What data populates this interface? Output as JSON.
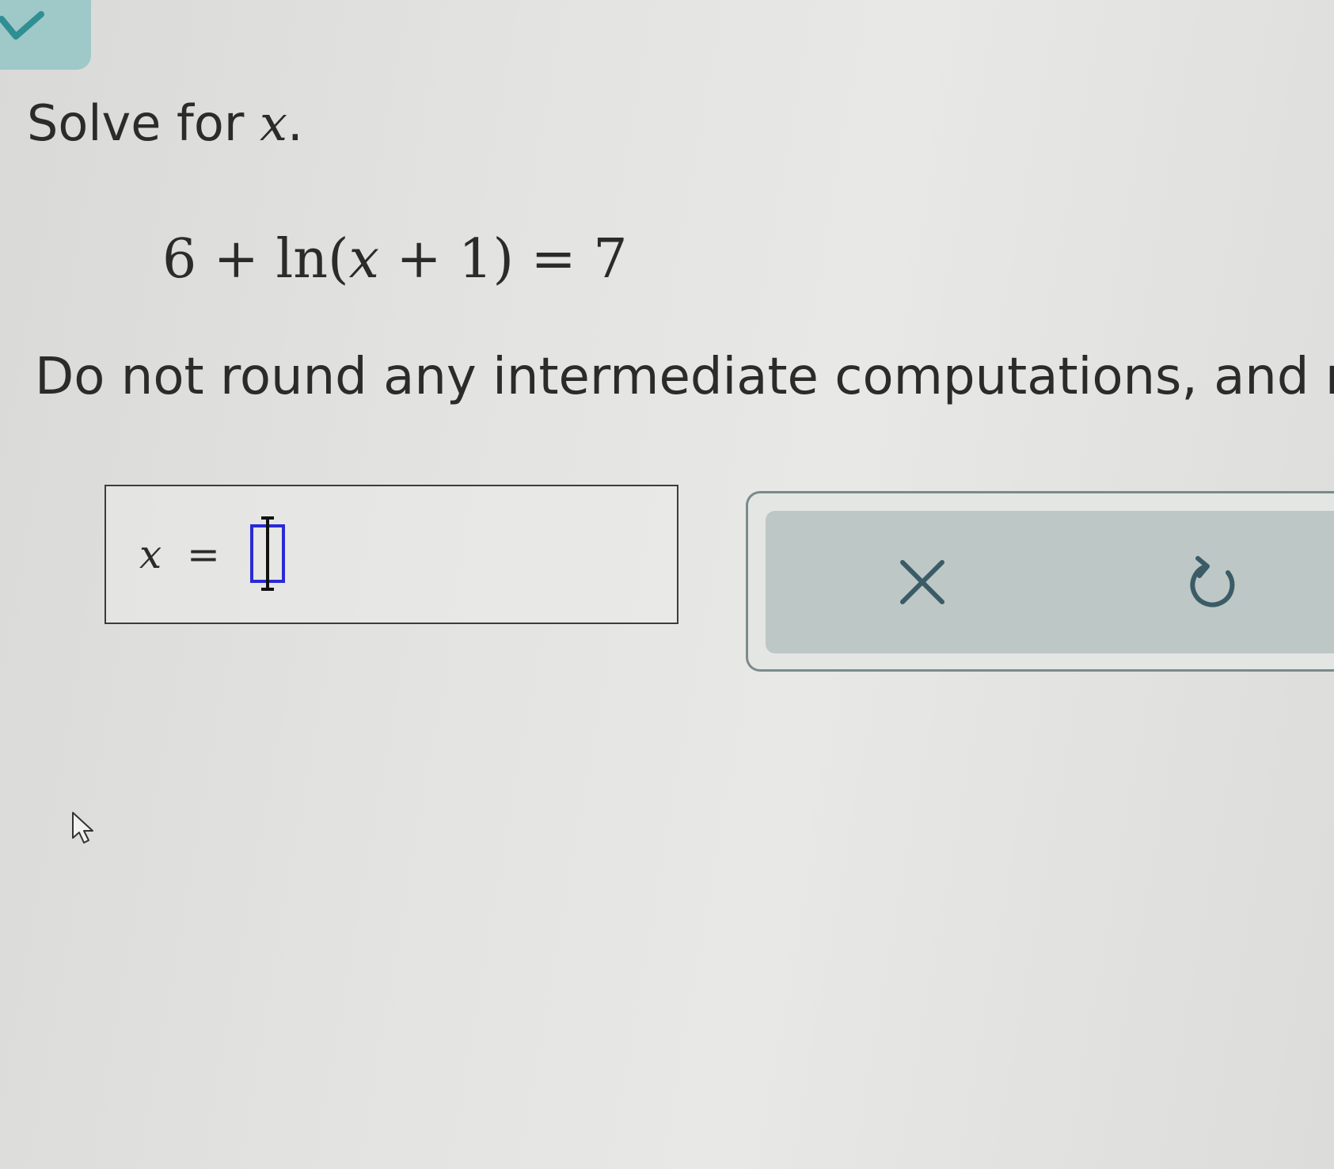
{
  "question": {
    "prompt_prefix": "Solve for ",
    "prompt_variable": "x",
    "prompt_suffix": ".",
    "equation": {
      "constant": "6",
      "plus": "+",
      "func": "ln",
      "open": "(",
      "variable": "x",
      "plus2": "+",
      "one": "1",
      "close": ")",
      "equals": "=",
      "rhs": "7"
    },
    "instruction": "Do not round any intermediate computations, and rour"
  },
  "answer": {
    "variable": "x",
    "equals": "=",
    "value": ""
  },
  "tools": {
    "clear_icon": "close-icon",
    "undo_icon": "undo-icon"
  },
  "colors": {
    "accent": "#9fc8c8",
    "check": "#2f8f92",
    "input_border": "#2a2ad6",
    "toolbar": "#bdc7c6",
    "icon": "#3b5c66"
  }
}
